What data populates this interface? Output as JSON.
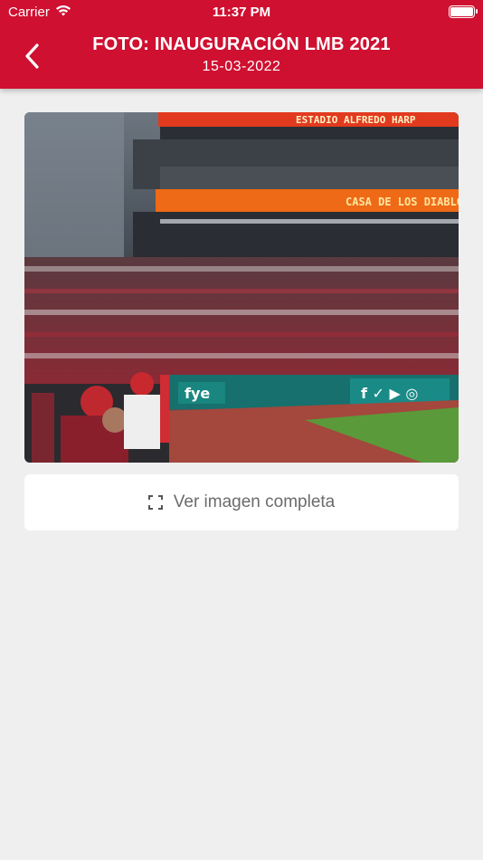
{
  "status": {
    "carrier": "Carrier",
    "time": "11:37 PM"
  },
  "header": {
    "title": "FOTO: INAUGURACIÓN LMB 2021",
    "date": "15-03-2022",
    "back_icon": "chevron-left-icon"
  },
  "photo": {
    "alt": "Estadio Alfredo Harp Helú - inauguración",
    "banner_top": "ESTADIO ALFREDO HARP",
    "banner_mid": "CASA DE LOS DIABLOS"
  },
  "actions": {
    "view_full_label": "Ver imagen completa",
    "view_full_icon": "expand-icon"
  },
  "colors": {
    "accent": "#cf1031",
    "background": "#efefef"
  }
}
